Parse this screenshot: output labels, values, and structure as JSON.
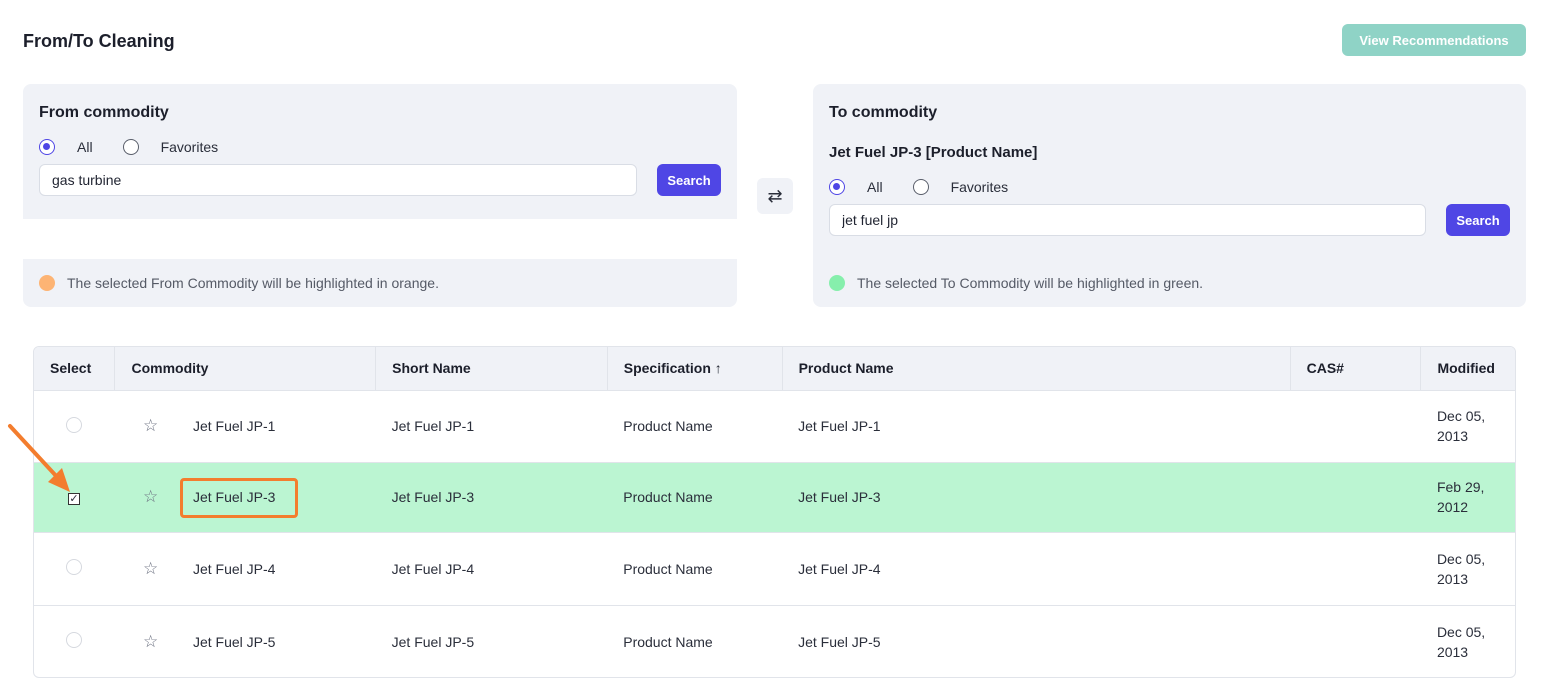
{
  "page": {
    "title": "From/To Cleaning",
    "view_recommendations": "View Recommendations",
    "accent_color": "#4f46e5",
    "view_button_color": "#8fd3c6"
  },
  "from_panel": {
    "heading": "From commodity",
    "radio_all": "All",
    "radio_favorites": "Favorites",
    "selected_radio": "All",
    "search_value": "gas turbine",
    "search_button": "Search",
    "hint": "The selected From Commodity will be highlighted in orange.",
    "hint_color": "#fdb474"
  },
  "swap_button": {
    "icon": "swap-arrows-icon",
    "glyph": "⇄"
  },
  "to_panel": {
    "heading": "To commodity",
    "selected_commodity": "Jet Fuel JP-3 [Product Name]",
    "radio_all": "All",
    "radio_favorites": "Favorites",
    "selected_radio": "All",
    "search_value": "jet fuel jp",
    "search_button": "Search",
    "hint": "The selected To Commodity will be highlighted in green.",
    "hint_color": "#86efac"
  },
  "table": {
    "columns": [
      "Select",
      "Commodity",
      "Short Name",
      "Specification ↑",
      "Product Name",
      "CAS#",
      "Modified"
    ],
    "selected_row_color": "#bbf5d2",
    "rows": [
      {
        "commodity": "Jet Fuel JP-1",
        "short_name": "Jet Fuel JP-1",
        "specification": "Product Name",
        "product_name": "Jet Fuel JP-1",
        "cas": "",
        "modified_1": "Dec 05,",
        "modified_2": "2013",
        "selected": false
      },
      {
        "commodity": "Jet Fuel JP-3",
        "short_name": "Jet Fuel JP-3",
        "specification": "Product Name",
        "product_name": "Jet Fuel JP-3",
        "cas": "",
        "modified_1": "Feb 29,",
        "modified_2": "2012",
        "selected": true
      },
      {
        "commodity": "Jet Fuel JP-4",
        "short_name": "Jet Fuel JP-4",
        "specification": "Product Name",
        "product_name": "Jet Fuel JP-4",
        "cas": "",
        "modified_1": "Dec 05,",
        "modified_2": "2013",
        "selected": false
      },
      {
        "commodity": "Jet Fuel JP-5",
        "short_name": "Jet Fuel JP-5",
        "specification": "Product Name",
        "product_name": "Jet Fuel JP-5",
        "cas": "",
        "modified_1": "Dec 05,",
        "modified_2": "2013",
        "selected": false
      }
    ]
  },
  "annotation": {
    "highlight_color": "#f37d2e"
  }
}
